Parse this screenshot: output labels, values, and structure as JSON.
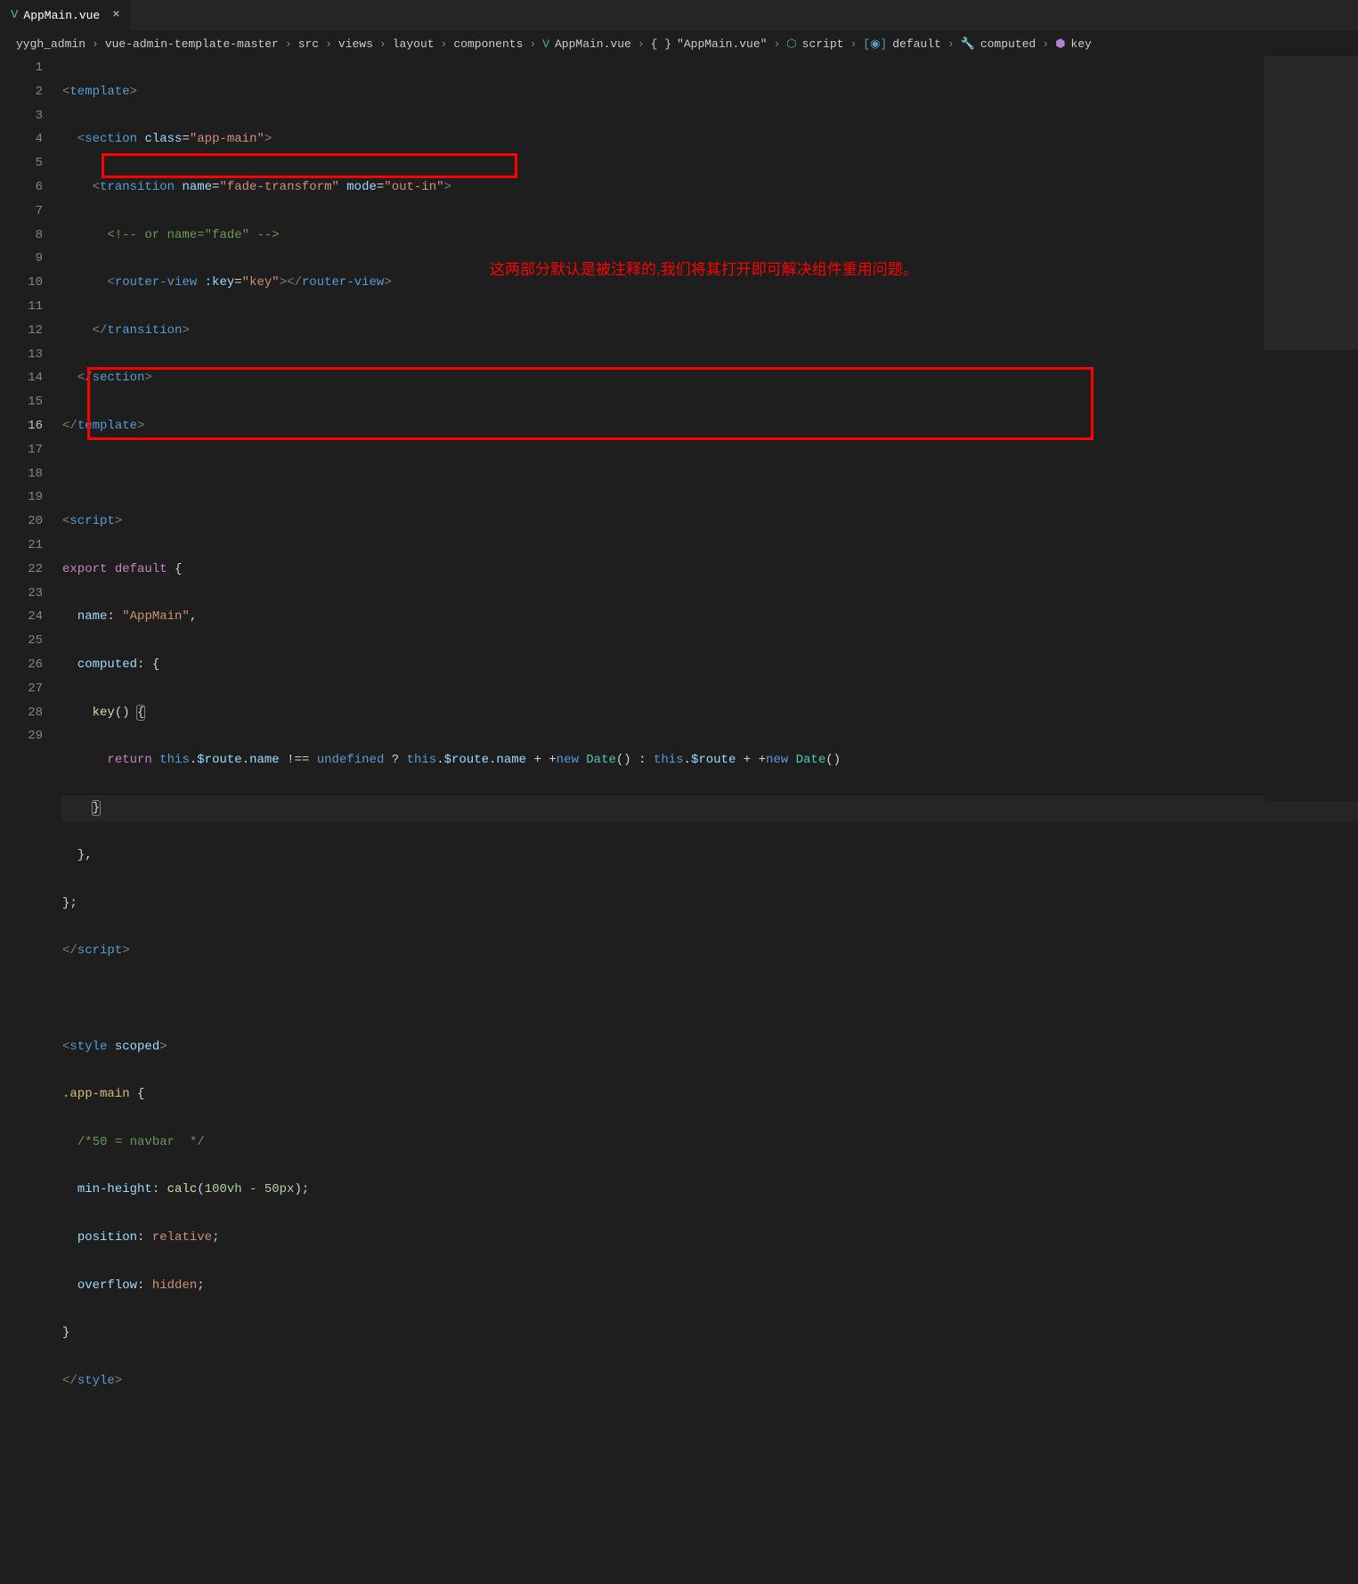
{
  "tab": {
    "filename": "AppMain.vue",
    "close": "×"
  },
  "breadcrumbs": [
    {
      "label": "yygh_admin"
    },
    {
      "label": "vue-admin-template-master"
    },
    {
      "label": "src"
    },
    {
      "label": "views"
    },
    {
      "label": "layout"
    },
    {
      "label": "components"
    },
    {
      "label": "AppMain.vue",
      "icon": "vue"
    },
    {
      "label": "\"AppMain.vue\"",
      "icon": "braces"
    },
    {
      "label": "script",
      "icon": "script"
    },
    {
      "label": "default",
      "icon": "default"
    },
    {
      "label": "computed",
      "icon": "wrench"
    },
    {
      "label": "key",
      "icon": "cube"
    }
  ],
  "annotation": "这两部分默认是被注释的,我们将其打开即可解决组件重用问题。",
  "lineNumbers": [
    "1",
    "2",
    "3",
    "4",
    "5",
    "6",
    "7",
    "8",
    "9",
    "10",
    "11",
    "12",
    "13",
    "14",
    "15",
    "16",
    "17",
    "18",
    "19",
    "20",
    "21",
    "22",
    "23",
    "24",
    "25",
    "26",
    "27",
    "28",
    "29"
  ],
  "code": {
    "l1": {
      "open": "<",
      "tag": "template",
      "close": ">"
    },
    "l2": {
      "open": "<",
      "tag": "section",
      "sp": " ",
      "attr": "class",
      "eq": "=",
      "val": "\"app-main\"",
      "close": ">"
    },
    "l3": {
      "open": "<",
      "tag": "transition",
      "sp": " ",
      "attr1": "name",
      "eq": "=",
      "val1": "\"fade-transform\"",
      "sp2": " ",
      "attr2": "mode",
      "val2": "\"out-in\"",
      "close": ">"
    },
    "l4": {
      "c": "<!-- or name=\"fade\" -->"
    },
    "l5": {
      "open": "<",
      "tag": "router-view",
      "sp": " ",
      "attr": ":key",
      "eq": "=",
      "val": "\"key\"",
      "close": ">",
      "open2": "</",
      "tag2": "router-view",
      "close2": ">"
    },
    "l6": {
      "open": "</",
      "tag": "transition",
      "close": ">"
    },
    "l7": {
      "open": "</",
      "tag": "section",
      "close": ">"
    },
    "l8": {
      "open": "</",
      "tag": "template",
      "close": ">"
    },
    "l10": {
      "open": "<",
      "tag": "script",
      "close": ">"
    },
    "l11": {
      "kw": "export",
      "sp": " ",
      "kw2": "default",
      "sp2": " ",
      "br": "{"
    },
    "l12": {
      "id": "name",
      "colon": ":",
      "sp": " ",
      "val": "\"AppMain\"",
      "comma": ","
    },
    "l13": {
      "id": "computed",
      "colon": ":",
      "sp": " ",
      "br": "{"
    },
    "l14": {
      "fn": "key",
      "paren": "()",
      "sp": " ",
      "br": "{"
    },
    "l15": {
      "kw": "return",
      "sp": " ",
      "this": "this",
      "dot": ".",
      "id1": "$route",
      "dot2": ".",
      "id2": "name",
      "sp2": " ",
      "op": "!==",
      "sp3": " ",
      "undef": "undefined",
      "sp4": " ",
      "q": "?",
      "sp5": " ",
      "this2": "this",
      "dot3": ".",
      "id3": "$route",
      "dot4": ".",
      "id4": "name",
      "sp6": " ",
      "plus": "+",
      "sp7": " ",
      "plus2": "+",
      "new": "new",
      "sp8": " ",
      "type": "Date",
      "paren": "()",
      "sp9": " ",
      "colon": ":",
      "sp10": " ",
      "this3": "this",
      "dot5": ".",
      "id5": "$route",
      "sp11": " ",
      "plus3": "+",
      "sp12": " ",
      "plus4": "+",
      "new2": "new",
      "sp13": " ",
      "type2": "Date",
      "paren2": "()"
    },
    "l16": {
      "br": "}"
    },
    "l17": {
      "br": "}",
      "comma": ","
    },
    "l18": {
      "br": "}",
      "semi": ";"
    },
    "l19": {
      "open": "</",
      "tag": "script",
      "close": ">"
    },
    "l21": {
      "open": "<",
      "tag": "style",
      "sp": " ",
      "attr": "scoped",
      "close": ">"
    },
    "l22": {
      "sel": ".app-main",
      "sp": " ",
      "br": "{"
    },
    "l23": {
      "c": "/*50 = navbar  */"
    },
    "l24": {
      "prop": "min-height",
      "colon": ":",
      "sp": " ",
      "fn": "calc",
      "open": "(",
      "val": "100vh - 50px",
      "close": ")",
      "semi": ";"
    },
    "l25": {
      "prop": "position",
      "colon": ":",
      "sp": " ",
      "val": "relative",
      "semi": ";"
    },
    "l26": {
      "prop": "overflow",
      "colon": ":",
      "sp": " ",
      "val": "hidden",
      "semi": ";"
    },
    "l27": {
      "br": "}"
    },
    "l28": {
      "open": "</",
      "tag": "style",
      "close": ">"
    }
  }
}
